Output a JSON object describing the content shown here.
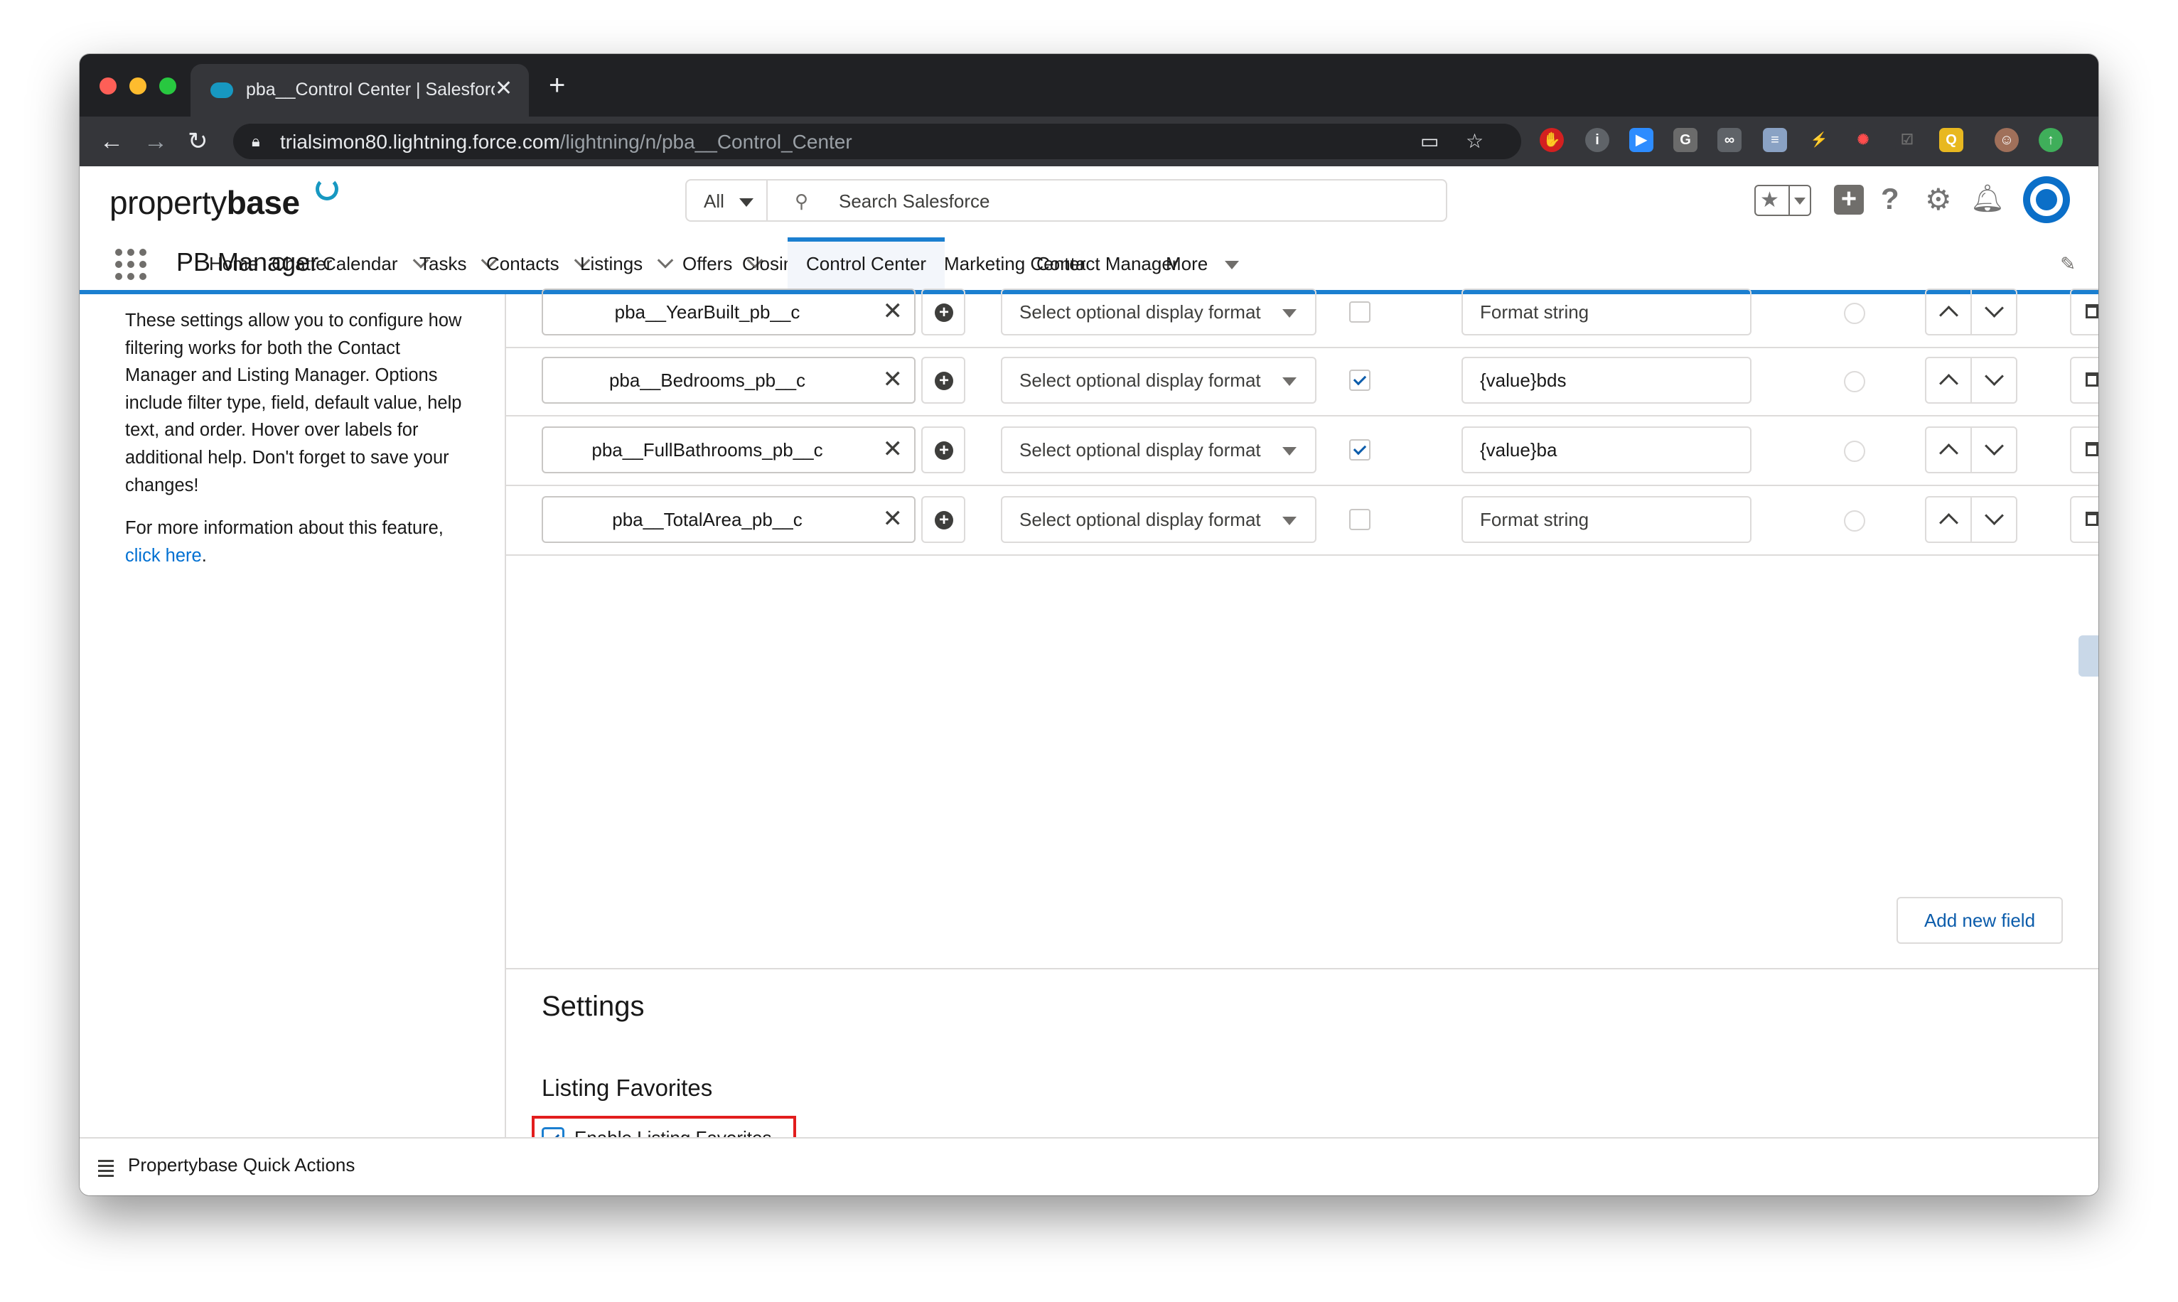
{
  "browser": {
    "tab_title": "pba__Control Center | Salesforce",
    "url_domain": "trialsimon80.lightning.force.com",
    "url_path": "/lightning/n/pba__Control_Center",
    "new_tab_icon": "plus-icon"
  },
  "header": {
    "logo_text_light": "property",
    "logo_text_bold": "base",
    "search_scope": "All",
    "search_placeholder": "Search Salesforce"
  },
  "nav": {
    "app_name": "PB Manager",
    "items": [
      {
        "label": "Home",
        "dropdown": false
      },
      {
        "label": "Chatter",
        "dropdown": false
      },
      {
        "label": "Calendar",
        "dropdown": true
      },
      {
        "label": "Tasks",
        "dropdown": true
      },
      {
        "label": "Contacts",
        "dropdown": true
      },
      {
        "label": "Listings",
        "dropdown": true
      },
      {
        "label": "Offers",
        "dropdown": true
      },
      {
        "label": "Closings",
        "dropdown": true
      },
      {
        "label": "Control Center",
        "dropdown": false,
        "active": true
      },
      {
        "label": "Marketing Center",
        "dropdown": false
      },
      {
        "label": "Contact Manager",
        "dropdown": false
      },
      {
        "label": "More",
        "dropdown": true
      }
    ]
  },
  "sidebar": {
    "description": "These settings allow you to configure how filtering works for both the Contact Manager and Listing Manager. Options include filter type, field, default value, help text, and order. Hover over labels for additional help. Don't forget to save your changes!",
    "more_info": "For more information about this feature,",
    "link_text": "click here",
    "period": "."
  },
  "rows": [
    {
      "field": "pba__YearBuilt_pb__c",
      "display_format": "Select optional display format",
      "checked": false,
      "format_value": "",
      "format_placeholder": "Format string"
    },
    {
      "field": "pba__Bedrooms_pb__c",
      "display_format": "Select optional display format",
      "checked": true,
      "format_value": "{value}bds",
      "format_placeholder": "Format string"
    },
    {
      "field": "pba__FullBathrooms_pb__c",
      "display_format": "Select optional display format",
      "checked": true,
      "format_value": "{value}ba",
      "format_placeholder": "Format string"
    },
    {
      "field": "pba__TotalArea_pb__c",
      "display_format": "Select optional display format",
      "checked": false,
      "format_value": "",
      "format_placeholder": "Format string"
    }
  ],
  "add_field_label": "Add new field",
  "settings": {
    "title": "Settings",
    "favorites_heading": "Listing Favorites",
    "favorites_checkbox_label": "Enable Listing Favorites",
    "favorites_enabled": true
  },
  "footer": {
    "label": "Propertybase Quick Actions"
  },
  "colors": {
    "brand_blue": "#1b7fd0",
    "link_blue": "#0070d2",
    "highlight_red": "#e21d1d"
  }
}
